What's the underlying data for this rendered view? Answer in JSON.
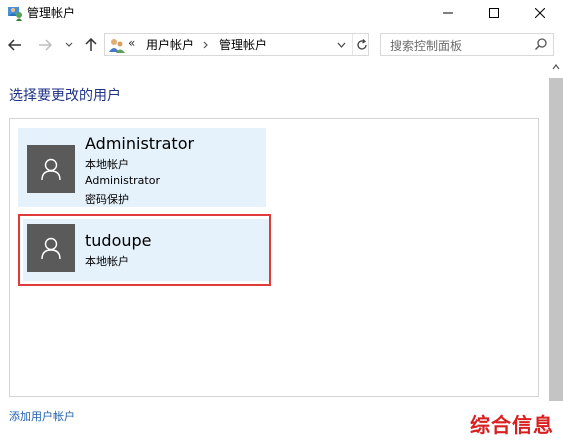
{
  "window": {
    "title": "管理帐户",
    "controls": {
      "minimize": "minimize-icon",
      "maximize": "maximize-icon",
      "close": "close-icon"
    }
  },
  "nav": {
    "breadcrumb_prefix": "«",
    "breadcrumbs": [
      {
        "label": "用户帐户"
      },
      {
        "label": "管理帐户"
      }
    ],
    "search_placeholder": "搜索控制面板"
  },
  "main": {
    "heading": "选择要更改的用户",
    "users": [
      {
        "name": "Administrator",
        "lines": [
          "本地帐户",
          "Administrator",
          "密码保护"
        ],
        "selected": false
      },
      {
        "name": "tudoupe",
        "lines": [
          "本地帐户"
        ],
        "selected": true
      }
    ],
    "add_user_link": "添加用户帐户"
  },
  "watermark": "综合信息",
  "colors": {
    "accent": "#1e3287",
    "link": "#1f5fb0",
    "tile_bg": "#e5f1fb",
    "selection_border": "#e03a3a",
    "avatar_bg": "#5a5a5a"
  }
}
